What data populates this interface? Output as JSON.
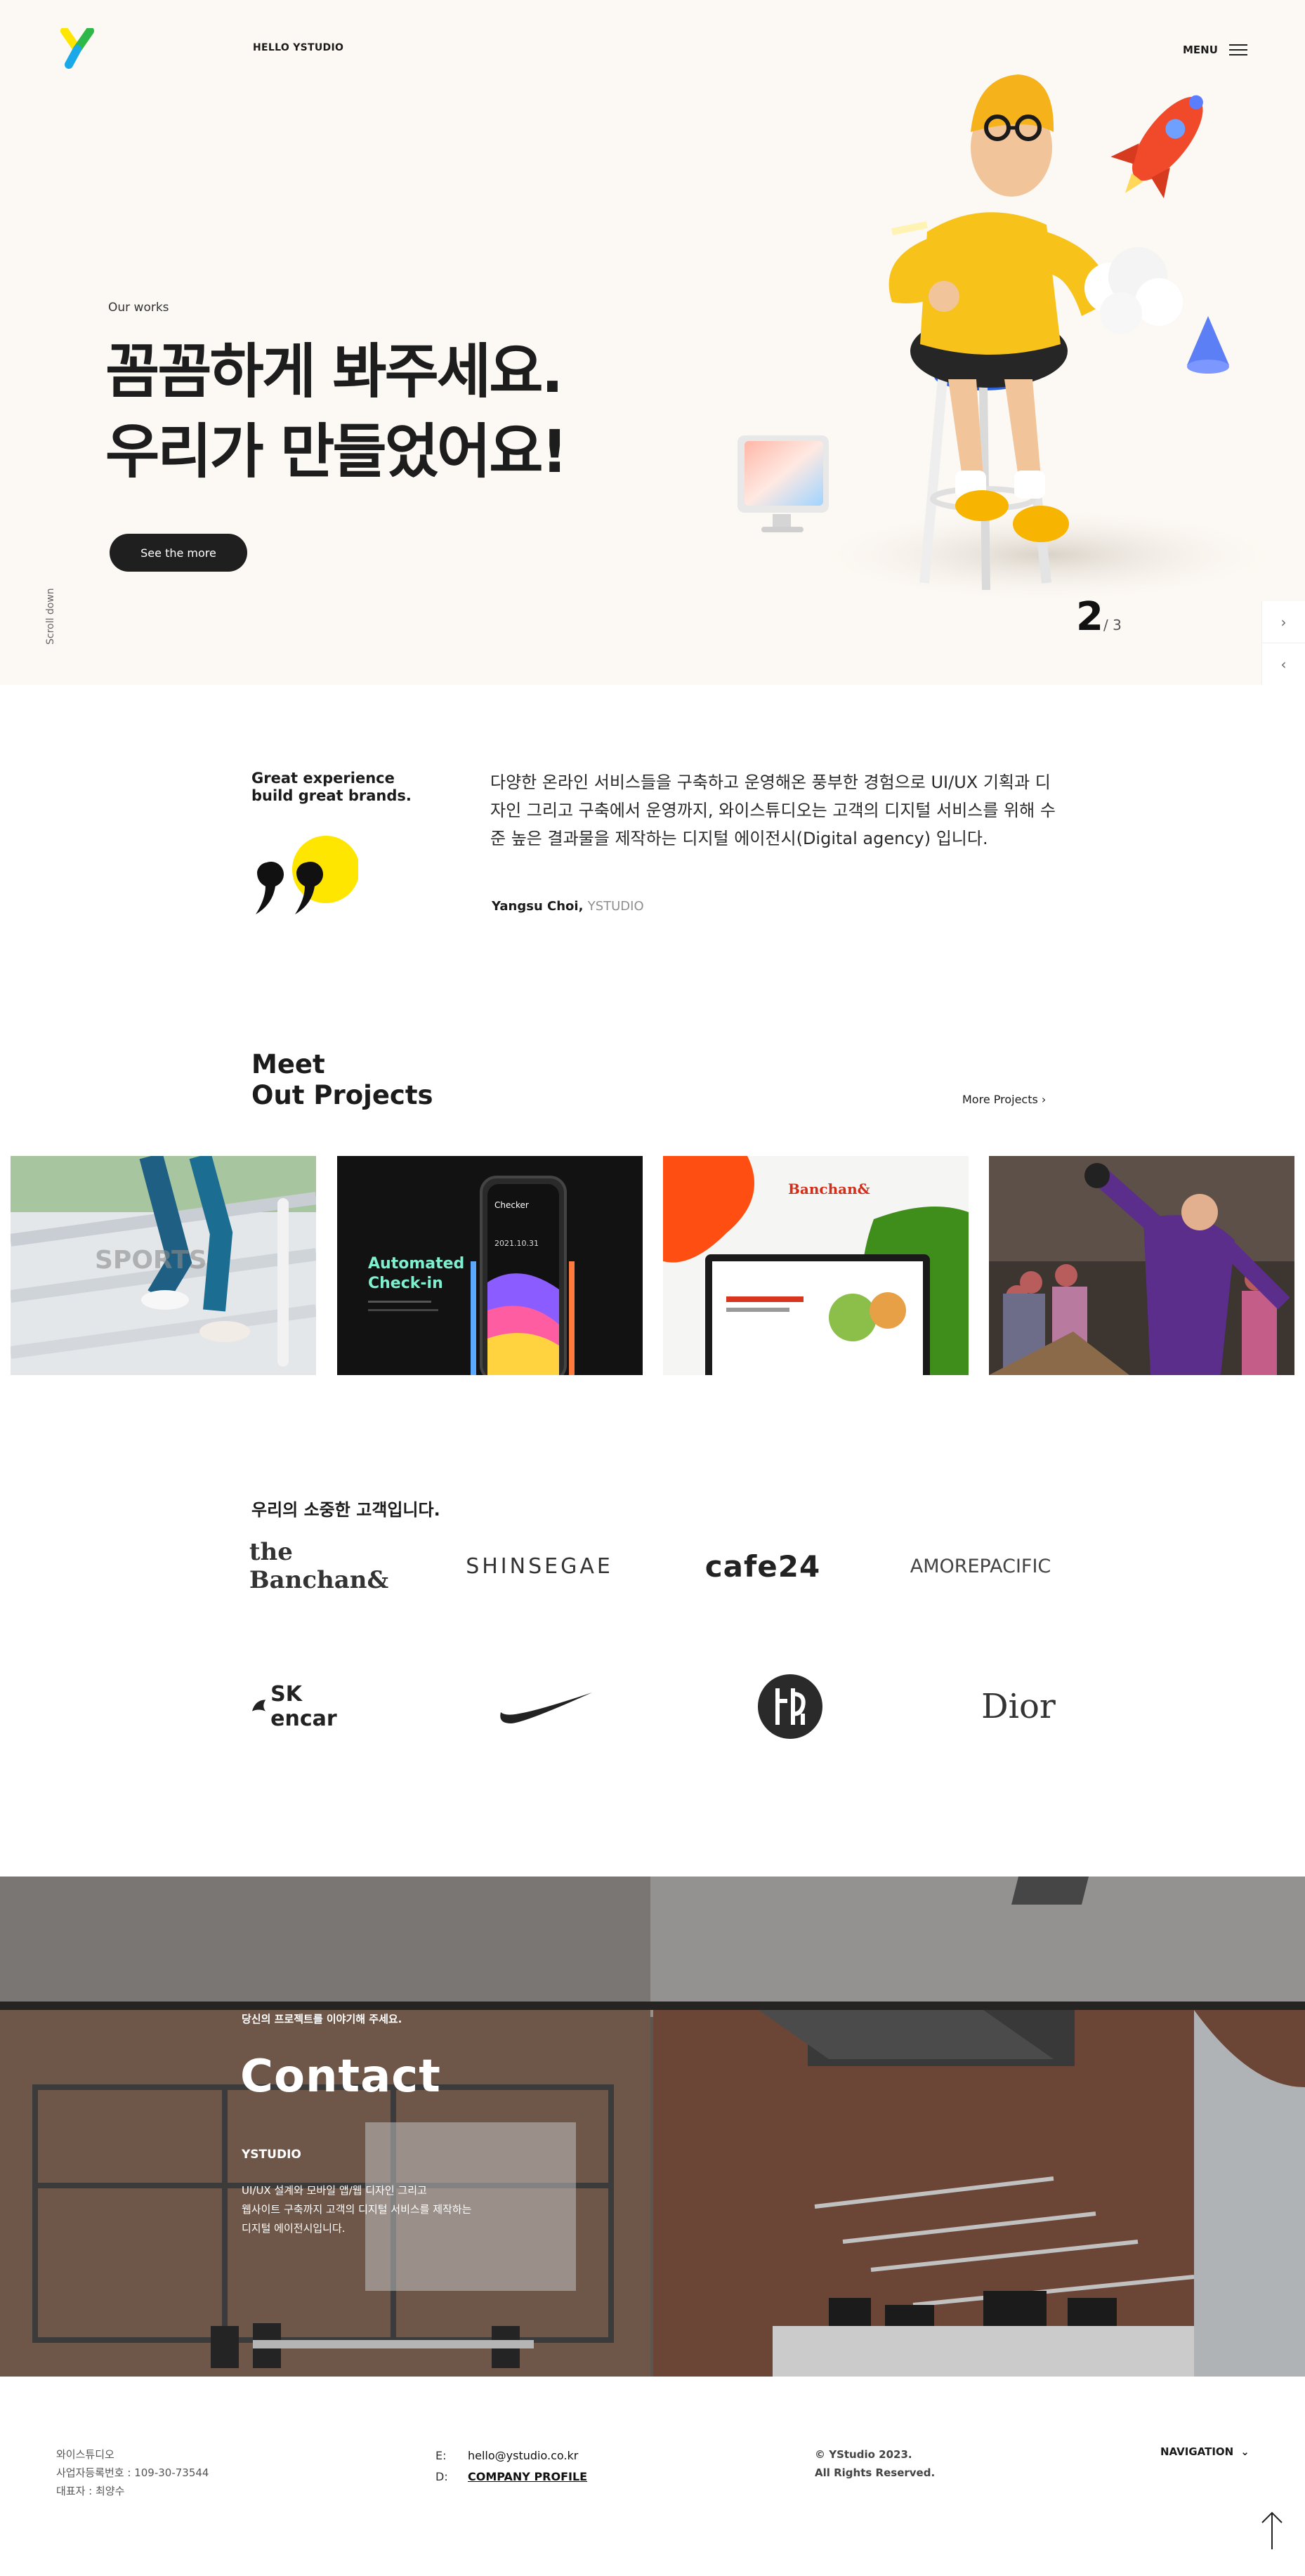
{
  "header": {
    "brand": "HELLO YSTUDIO",
    "menu_label": "MENU"
  },
  "hero": {
    "eyebrow": "Our works",
    "headline_line1": "꼼꼼하게 봐주세요.",
    "headline_line2": "우리가 만들었어요!",
    "cta": "See the more",
    "scroll_hint": "Scroll down",
    "slide_current": "2",
    "slide_total": "/ 3"
  },
  "about": {
    "tagline_line1": "Great experience",
    "tagline_line2": "build great brands.",
    "body": "다양한 온라인 서비스들을 구축하고 운영해온 풍부한 경험으로 UI/UX 기획과 디자인 그리고 구축에서 운영까지, 와이스튜디오는 고객의 디지털 서비스를 위해 수준 높은 결과물을 제작하는 디지털 에이전시(Digital agency) 입니다.",
    "author": "Yangsu Choi,",
    "company": "YSTUDIO"
  },
  "projects": {
    "title_line1": "Meet",
    "title_line2": "Out Projects",
    "more": "More Projects",
    "cards": [
      {
        "id": "sports",
        "overlay": "SPORTS"
      },
      {
        "id": "checker",
        "title": "Automated Check-in",
        "app": "Checker",
        "date": "2021.10.31"
      },
      {
        "id": "banchan",
        "brand": "the Banchan&"
      },
      {
        "id": "bowling"
      }
    ]
  },
  "clients": {
    "title": "우리의 소중한 고객입니다.",
    "logos": [
      "the Banchan&",
      "SHINSEGAE",
      "cafe24",
      "AMOREPACIFIC",
      "SK encar",
      "Nike",
      "Sulwhasoo",
      "Dior"
    ]
  },
  "contact": {
    "eyebrow": "당신의 프로젝트를 이야기해 주세요.",
    "title": "Contact",
    "company": "YSTUDIO",
    "desc_line1": "UI/UX 설계와 모바일 앱/웹 디자인 그리고",
    "desc_line2": "웹사이트 구축까지 고객의 디지털 서비스를 제작하는",
    "desc_line3": "디지털 에이전시입니다."
  },
  "footer": {
    "company_name": "와이스튜디오",
    "biz_no": "사업자등록번호 : 109-30-73544",
    "ceo": "대표자 : 최양수",
    "email_key": "E:",
    "email": "hello@ystudio.co.kr",
    "doc_key": "D:",
    "profile": "COMPANY PROFILE",
    "copyright": "© YStudio 2023.",
    "rights": "All Rights Reserved.",
    "nav": "NAVIGATION"
  },
  "colors": {
    "accent_yellow": "#ffe600",
    "logo_green": "#2fb84a",
    "logo_blue": "#1aa9e8",
    "dark": "#1f1f1f",
    "hero_bg": "#fcf8f3"
  }
}
